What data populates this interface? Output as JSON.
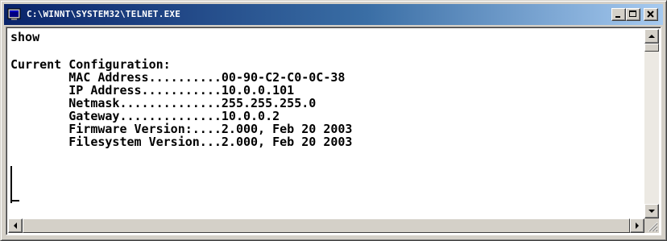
{
  "window": {
    "title": "C:\\WINNT\\SYSTEM32\\TELNET.EXE",
    "app_icon": "console-window-icon",
    "controls": {
      "minimize_icon": "minimize-icon",
      "maximize_icon": "maximize-icon",
      "close_icon": "close-icon"
    }
  },
  "console": {
    "lines": [
      "show",
      "",
      "Current Configuration:",
      "        MAC Address..........00-90-C2-C0-0C-38",
      "        IP Address...........10.0.0.101",
      "        Netmask..............255.255.255.0",
      "        Gateway..............10.0.0.2",
      "        Firmware Version:....2.000, Feb 20 2003",
      "        Filesystem Version...2.000, Feb 20 2003"
    ]
  },
  "scrollbars": {
    "vertical": {
      "up_icon": "scroll-up-arrow-icon",
      "down_icon": "scroll-down-arrow-icon"
    },
    "horizontal": {
      "left_icon": "scroll-left-arrow-icon",
      "right_icon": "scroll-right-arrow-icon"
    }
  },
  "colors": {
    "titlebar_start": "#0a246a",
    "titlebar_end": "#a6caf0",
    "chrome": "#d4d0c8",
    "console_bg": "#ffffff",
    "console_text": "#000000"
  }
}
